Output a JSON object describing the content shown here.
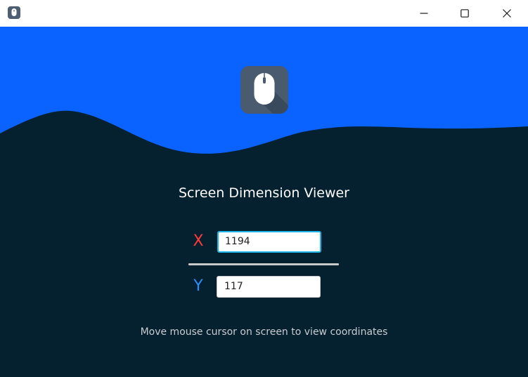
{
  "window": {
    "app_icon": "mouse-icon",
    "controls": {
      "minimize_icon": "minimize-icon",
      "maximize_icon": "maximize-icon",
      "close_icon": "close-icon"
    }
  },
  "colors": {
    "sky": "#0a62ff",
    "wave": "#05202f",
    "x_label": "#ff3b3b",
    "y_label": "#2d8cff",
    "focus_border": "#1fb4e8"
  },
  "main": {
    "logo_icon": "mouse-icon",
    "title": "Screen Dimension Viewer",
    "x_label": "X",
    "y_label": "Y",
    "x_value": "1194",
    "y_value": "117",
    "hint": "Move mouse cursor on screen to view coordinates"
  }
}
